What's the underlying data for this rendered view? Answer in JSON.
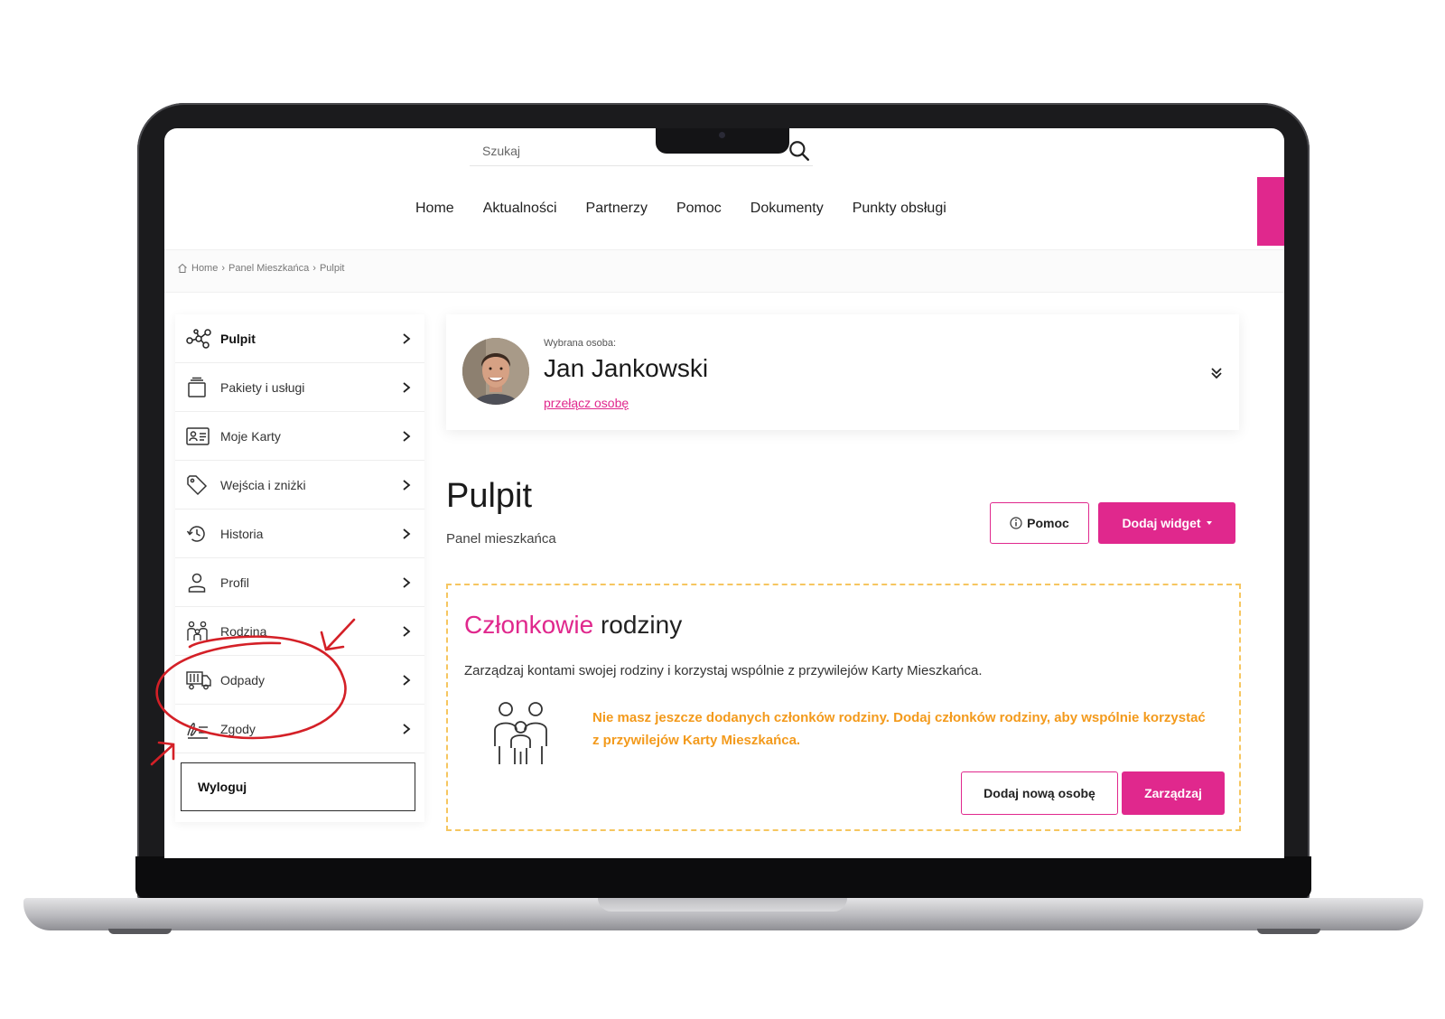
{
  "search": {
    "placeholder": "Szukaj"
  },
  "nav": {
    "items": [
      "Home",
      "Aktualności",
      "Partnerzy",
      "Pomoc",
      "Dokumenty",
      "Punkty obsługi"
    ]
  },
  "breadcrumb": [
    "Home",
    "Panel Mieszkańca",
    "Pulpit"
  ],
  "sidebar": {
    "items": [
      {
        "label": "Pulpit",
        "icon": "dashboard-icon",
        "active": true
      },
      {
        "label": "Pakiety i usługi",
        "icon": "package-icon"
      },
      {
        "label": "Moje Karty",
        "icon": "id-card-icon"
      },
      {
        "label": "Wejścia i zniżki",
        "icon": "tag-icon"
      },
      {
        "label": "Historia",
        "icon": "history-icon"
      },
      {
        "label": "Profil",
        "icon": "user-icon"
      },
      {
        "label": "Rodzina",
        "icon": "family-icon"
      },
      {
        "label": "Odpady",
        "icon": "garbage-truck-icon"
      },
      {
        "label": "Zgody",
        "icon": "signature-icon"
      }
    ],
    "logout": "Wyloguj"
  },
  "person": {
    "caption": "Wybrana osoba:",
    "name": "Jan Jankowski",
    "switch_link": "przełącz osobę"
  },
  "page": {
    "title": "Pulpit",
    "subtitle": "Panel mieszkańca",
    "help_button": "Pomoc",
    "add_widget_button": "Dodaj widget"
  },
  "family_widget": {
    "title_accent": "Członkowie",
    "title_rest": "rodziny",
    "description": "Zarządzaj kontami swojej rodziny i korzystaj wspólnie z przywilejów Karty Mieszkańca.",
    "empty_message": "Nie masz jeszcze dodanych członków rodziny. Dodaj członków rodziny, aby wspólnie korzystać z przywilejów Karty Mieszkańca.",
    "add_button": "Dodaj nową osobę",
    "manage_button": "Zarządzaj"
  },
  "colors": {
    "accent": "#e0288d",
    "warning": "#f39a1c",
    "dashed_border": "#f6c660",
    "annotation": "#d42027"
  }
}
